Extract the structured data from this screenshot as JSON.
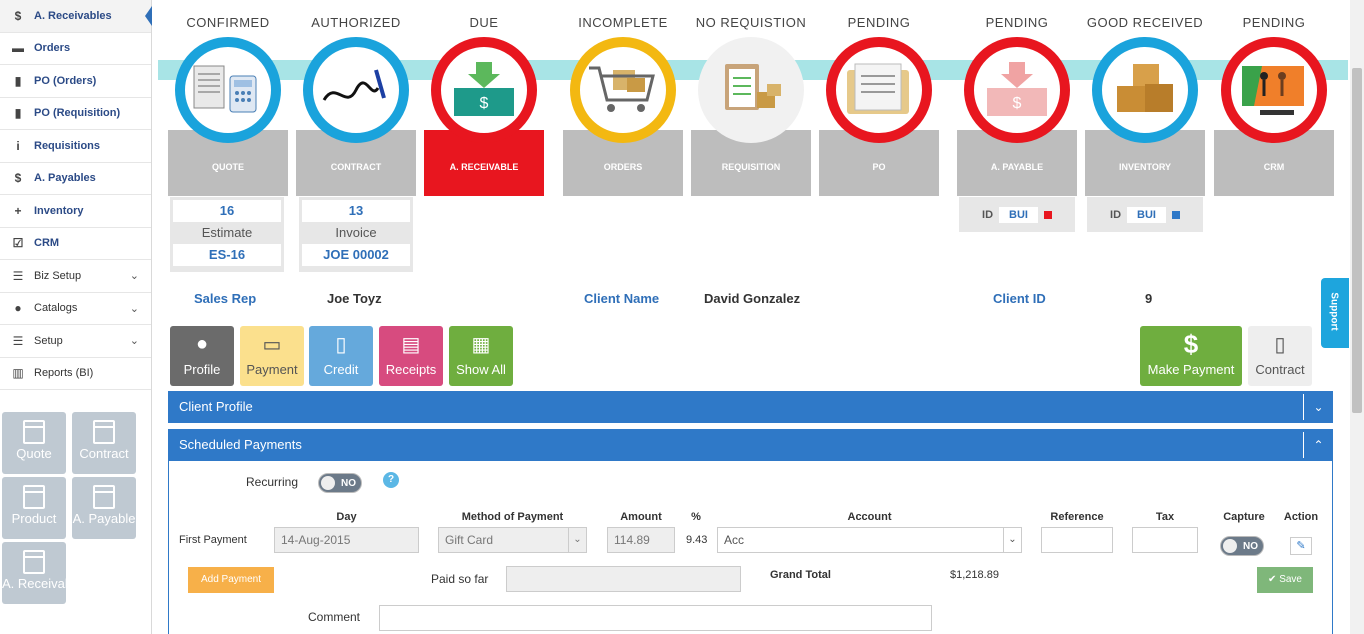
{
  "sidebar": {
    "items": [
      {
        "label": "A. Receivables",
        "icon": "dollar-icon",
        "glyph": "$"
      },
      {
        "label": "Orders",
        "icon": "cart-icon",
        "glyph": "🛒"
      },
      {
        "label": "PO (Orders)",
        "icon": "file-icon",
        "glyph": "▮"
      },
      {
        "label": "PO (Requisition)",
        "icon": "file-icon",
        "glyph": "▮"
      },
      {
        "label": "Requisitions",
        "icon": "info-icon",
        "glyph": "i"
      },
      {
        "label": "A. Payables",
        "icon": "dollar-icon",
        "glyph": "$"
      },
      {
        "label": "Inventory",
        "icon": "plus-icon",
        "glyph": "+"
      },
      {
        "label": "CRM",
        "icon": "checkbox-icon",
        "glyph": "☑"
      },
      {
        "label": "Biz Setup",
        "icon": "list-icon",
        "glyph": "☰"
      },
      {
        "label": "Catalogs",
        "icon": "palette-icon",
        "glyph": "⬤"
      },
      {
        "label": "Setup",
        "icon": "list-icon",
        "glyph": "☰"
      },
      {
        "label": "Reports (BI)",
        "icon": "chart-icon",
        "glyph": "▥"
      }
    ],
    "tiles": [
      "Quote",
      "Contract",
      "Product",
      "A. Payable",
      "A. Receivable"
    ]
  },
  "support_label": "Support",
  "stages": [
    {
      "title": "CONFIRMED",
      "label": "QUOTE",
      "ring": "blue"
    },
    {
      "title": "AUTHORIZED",
      "label": "CONTRACT",
      "ring": "blue"
    },
    {
      "title": "DUE",
      "label": "A. RECEIVABLE",
      "ring": "red"
    },
    {
      "title": "INCOMPLETE",
      "label": "ORDERS",
      "ring": "yellow"
    },
    {
      "title": "NO REQUISTION",
      "label": "REQUISITION",
      "ring": "none"
    },
    {
      "title": "PENDING",
      "label": "PO",
      "ring": "red"
    },
    {
      "title": "PENDING",
      "label": "A. PAYABLE",
      "ring": "red"
    },
    {
      "title": "GOOD RECEIVED",
      "label": "INVENTORY",
      "ring": "blue"
    },
    {
      "title": "PENDING",
      "label": "CRM",
      "ring": "red"
    }
  ],
  "quote_box": {
    "number": "16",
    "type": "Estimate",
    "code": "ES-16"
  },
  "contract_box": {
    "number": "13",
    "type": "Invoice",
    "code": "JOE 00002"
  },
  "id_boxes": [
    {
      "id": "ID",
      "value": "BUI",
      "color": "#e8161f"
    },
    {
      "id": "ID",
      "value": "BUI",
      "color": "#2f79c8"
    }
  ],
  "client": {
    "sales_rep_label": "Sales Rep",
    "sales_rep": "Joe Toyz",
    "client_name_label": "Client Name",
    "client_name": "David Gonzalez",
    "client_id_label": "Client ID",
    "client_id": "9"
  },
  "buttons": {
    "profile": "Profile",
    "payment": "Payment",
    "credit": "Credit",
    "receipts": "Receipts",
    "show_all": "Show All",
    "make_payment": "Make Payment",
    "contract": "Contract"
  },
  "panels": {
    "client_profile": "Client Profile",
    "scheduled_payments": "Scheduled Payments"
  },
  "payments": {
    "recurring_label": "Recurring",
    "recurring_value": "NO",
    "headers": {
      "day": "Day",
      "method": "Method of Payment",
      "amount": "Amount",
      "percent": "%",
      "account": "Account",
      "reference": "Reference",
      "tax": "Tax",
      "capture": "Capture",
      "action": "Action"
    },
    "first_payment_label": "First Payment",
    "day": "14-Aug-2015",
    "method": "Gift Card",
    "amount": "114.89",
    "percent": "9.43",
    "account": "Acc",
    "reference": "",
    "tax": "",
    "capture": "NO",
    "add_payment": "Add Payment",
    "paid_so_far_label": "Paid so far",
    "paid_so_far": "",
    "grand_total_label": "Grand Total",
    "grand_total": "$1,218.89",
    "save": "Save",
    "comment_label": "Comment",
    "comment": ""
  }
}
